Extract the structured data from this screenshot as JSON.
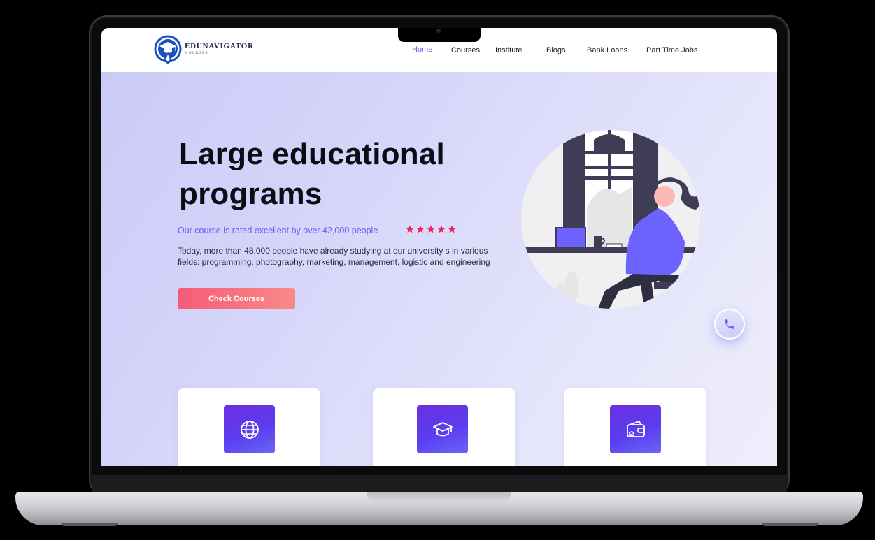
{
  "brand": {
    "name": "EDUNAVIGATOR",
    "tagline": "COURSES"
  },
  "nav": {
    "items": [
      {
        "label": "Home",
        "active": true
      },
      {
        "label": "Courses",
        "active": false
      },
      {
        "label": "Institute",
        "active": false
      },
      {
        "label": "Blogs",
        "active": false
      },
      {
        "label": "Bank Loans",
        "active": false
      },
      {
        "label": "Part Time Jobs",
        "active": false
      }
    ]
  },
  "hero": {
    "title_line1": "Large educational",
    "title_line2": "programs",
    "rating_text": "Our course is rated excellent by over 42,000 people",
    "rating_stars": 5,
    "description": "Today, more than 48,000 people have already studying  at our university s in various fields: programming, photography, marketing, management, logistic and engineering",
    "cta_label": "Check Courses"
  },
  "features": [
    {
      "icon": "globe-icon"
    },
    {
      "icon": "graduation-cap-icon"
    },
    {
      "icon": "wallet-icon"
    }
  ],
  "floating": {
    "icon": "phone-icon"
  },
  "colors": {
    "accent": "#6a5cf0",
    "cta_start": "#f45c7a",
    "cta_end": "#f98a86",
    "star": "#f0245a",
    "card_icon": "#5a3df0",
    "hero_bg": "#d7d7fb"
  }
}
